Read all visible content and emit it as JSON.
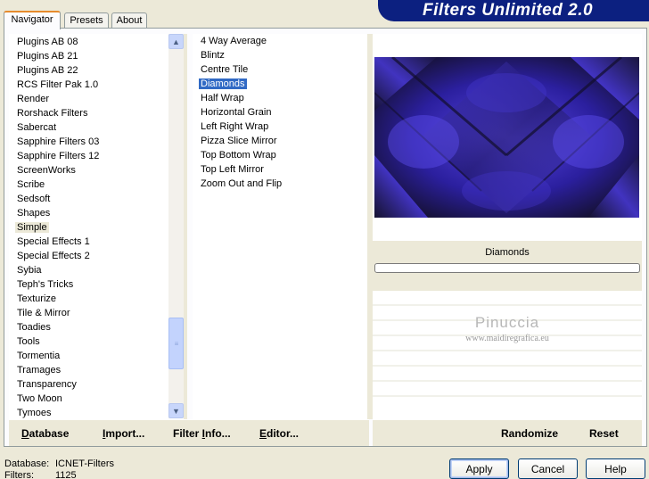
{
  "banner": {
    "title": "Filters Unlimited 2.0"
  },
  "tabs": [
    {
      "label": "Navigator",
      "active": true
    },
    {
      "label": "Presets",
      "active": false
    },
    {
      "label": "About",
      "active": false
    }
  ],
  "categories": [
    "Plugins AB 08",
    "Plugins AB 21",
    "Plugins AB 22",
    "RCS Filter Pak 1.0",
    "Render",
    "Rorshack Filters",
    "Sabercat",
    "Sapphire Filters 03",
    "Sapphire Filters 12",
    "ScreenWorks",
    "Scribe",
    "Sedsoft",
    "Shapes",
    "Simple",
    "Special Effects 1",
    "Special Effects 2",
    "Sybia",
    "Teph's Tricks",
    "Texturize",
    "Tile & Mirror",
    "Toadies",
    "Tools",
    "Tormentia",
    "Tramages",
    "Transparency",
    "Two Moon",
    "Tymoes"
  ],
  "selected_category": "Simple",
  "filters": [
    "4 Way Average",
    "Blintz",
    "Centre Tile",
    "Diamonds",
    "Half Wrap",
    "Horizontal Grain",
    "Left Right Wrap",
    "Pizza Slice Mirror",
    "Top Bottom Wrap",
    "Top Left Mirror",
    "Zoom Out and Flip"
  ],
  "selected_filter": "Diamonds",
  "preview": {
    "filter_name": "Diamonds",
    "watermark_title": "Pinuccia",
    "watermark_url": "www.maidiregrafica.eu",
    "colors": {
      "dark": "#1a1a2e",
      "light": "#4b3bd6",
      "mid": "#2a1f8c"
    }
  },
  "buttons": {
    "database": {
      "label": "Database",
      "mnemonic": "D",
      "rest": "atabase"
    },
    "import": {
      "label": "Import...",
      "mnemonic": "I",
      "rest": "mport..."
    },
    "filter_info": {
      "label": "Filter Info...",
      "pre": "Filter ",
      "mnemonic": "I",
      "rest": "nfo..."
    },
    "editor": {
      "label": "Editor...",
      "mnemonic": "E",
      "rest": "ditor..."
    },
    "randomize": "Randomize",
    "reset": "Reset",
    "apply": "Apply",
    "cancel": "Cancel",
    "help": "Help"
  },
  "status": {
    "database_label": "Database:",
    "database_value": "ICNET-Filters",
    "filters_label": "Filters:",
    "filters_value": "1125"
  }
}
